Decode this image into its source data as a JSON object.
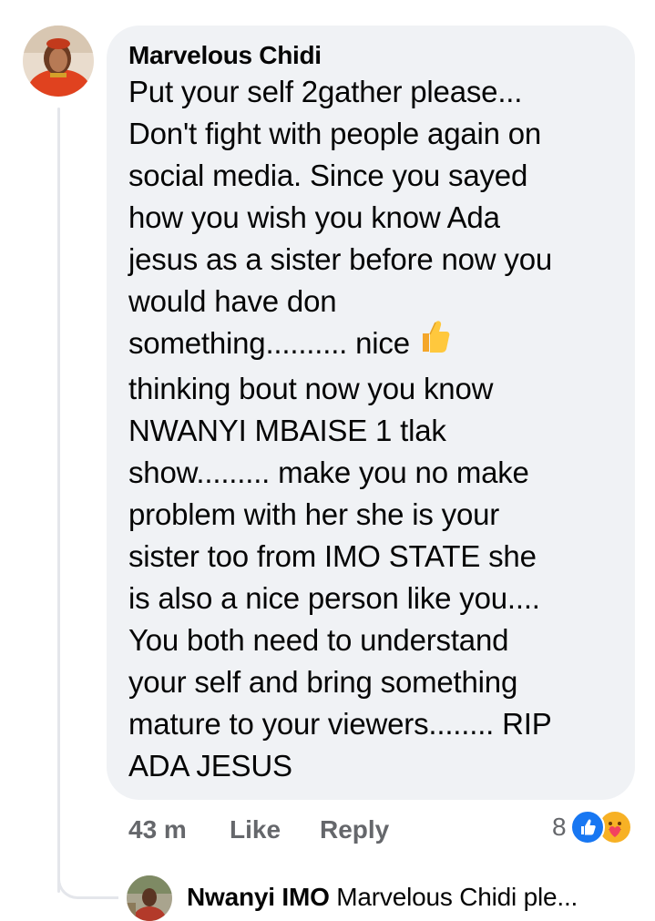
{
  "comment": {
    "author": "Marvelous Chidi",
    "text_lines": [
      "Put your self 2gather please...",
      "Don't fight with people again on",
      "social media. Since you sayed",
      "how you wish you know Ada",
      "jesus as a sister before now you",
      "would have don",
      "something.......... nice",
      "thinking bout now you know",
      "NWANYI MBAISE 1 tlak",
      "show......... make you no make",
      "problem with her she is your",
      "sister too from IMO STATE she",
      "is also a nice person like you....",
      "You both need to understand",
      "your self and bring something",
      "mature to your viewers........ RIP",
      "ADA JESUS"
    ],
    "inline_emoji": "thumbs-up-icon",
    "timestamp": "43 m",
    "like_label": "Like",
    "reply_label": "Reply",
    "reaction_count": "8",
    "reactions": [
      "like-reaction-icon",
      "care-reaction-icon"
    ]
  },
  "reply_preview": {
    "author": "Nwanyi IMO",
    "text": "Marvelous Chidi  ple..."
  },
  "colors": {
    "bubble_bg": "#f0f2f5",
    "meta_text": "#65676b",
    "like_blue": "#1877f2",
    "care_yellow": "#f7b125",
    "thread_line": "#e4e6eb"
  }
}
